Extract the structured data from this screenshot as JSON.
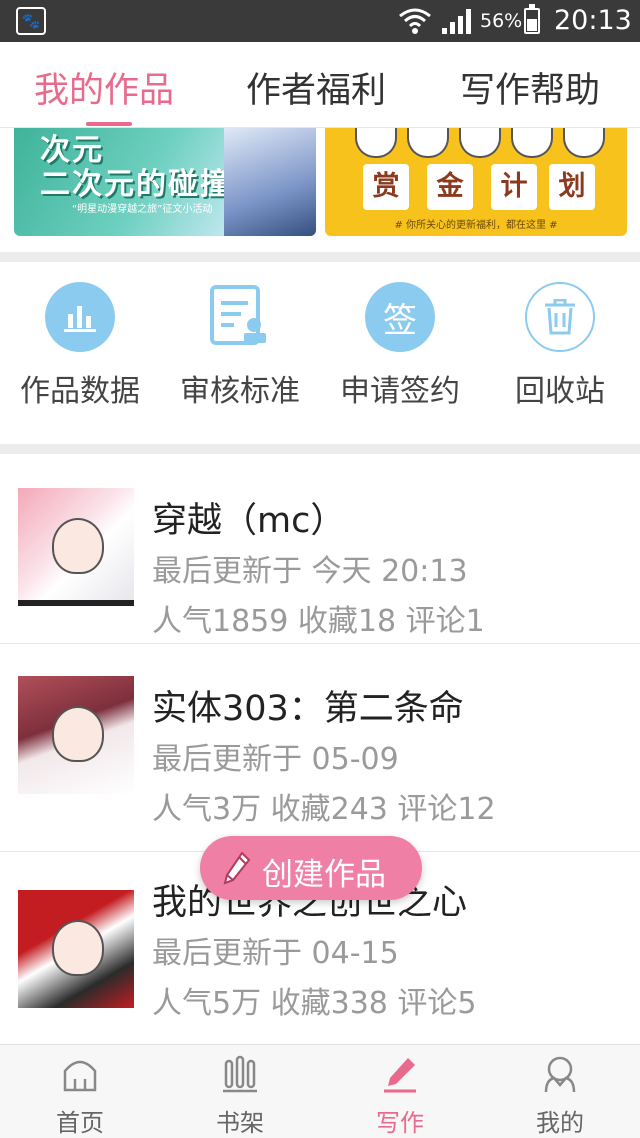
{
  "status_bar": {
    "battery_percent": "56%",
    "time": "20:13",
    "app_icon": "baidu-paw-icon"
  },
  "top_tabs": [
    {
      "label": "我的作品",
      "active": true
    },
    {
      "label": "作者福利",
      "active": false
    },
    {
      "label": "写作帮助",
      "active": false
    }
  ],
  "banners": {
    "left": {
      "headline_line1": "次元",
      "headline_line2": "二次元的碰撞",
      "caption": "“明星动漫穿越之旅”征文小活动"
    },
    "right": {
      "words": [
        "赏",
        "金",
        "计",
        "划"
      ],
      "caption": "# 你所关心的更新福利，都在这里 #"
    }
  },
  "actions": [
    {
      "label": "作品数据",
      "icon": "bar-chart-icon"
    },
    {
      "label": "审核标准",
      "icon": "document-review-icon"
    },
    {
      "label": "申请签约",
      "icon": "sign-icon",
      "icon_text": "签"
    },
    {
      "label": "回收站",
      "icon": "trash-icon"
    }
  ],
  "works": [
    {
      "title": "穿越（mc）",
      "updated": "最后更新于 今天 20:13",
      "stats": "人气1859 收藏18 评论1"
    },
    {
      "title": "实体303：第二条命",
      "updated": "最后更新于 05-09",
      "stats": "人气3万 收藏243 评论12"
    },
    {
      "title": "我的世界之创世之心",
      "updated": "最后更新于 04-15",
      "stats": "人气5万 收藏338 评论5"
    }
  ],
  "create_button": {
    "label": "创建作品"
  },
  "bottom_nav": [
    {
      "label": "首页",
      "icon": "home-icon",
      "active": false
    },
    {
      "label": "书架",
      "icon": "bookshelf-icon",
      "active": false
    },
    {
      "label": "写作",
      "icon": "pencil-icon",
      "active": true
    },
    {
      "label": "我的",
      "icon": "profile-icon",
      "active": false
    }
  ],
  "colors": {
    "accent": "#e96a8c",
    "icon_blue": "#8ccbf0",
    "fab": "#f07fa5",
    "banner_yellow": "#f7c21b"
  }
}
